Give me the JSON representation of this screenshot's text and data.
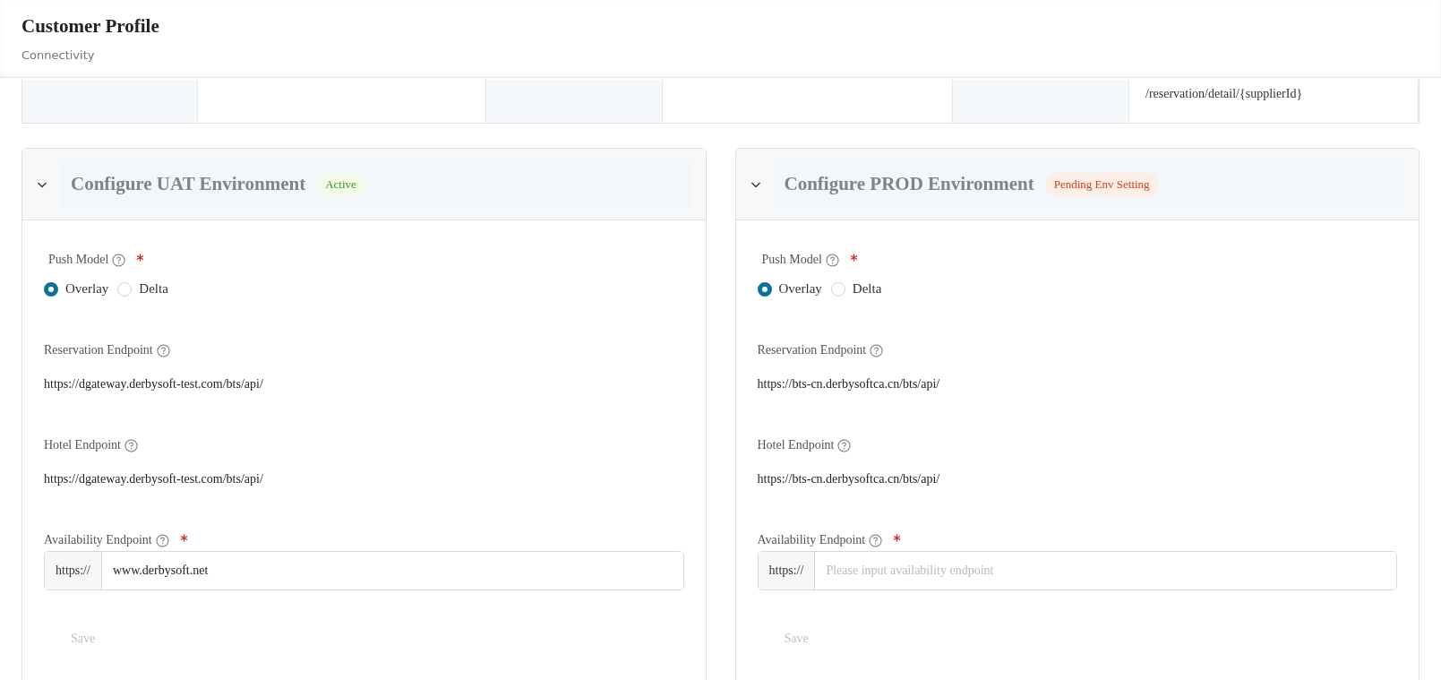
{
  "header": {
    "title": "Customer Profile",
    "subtitle": "Connectivity"
  },
  "top_row": {
    "cells": [
      {
        "kind": "label"
      },
      {
        "kind": "value"
      },
      {
        "kind": "label"
      },
      {
        "kind": "value"
      },
      {
        "kind": "label"
      },
      {
        "kind": "value",
        "text": "/reservation/detail/{supplierId}"
      }
    ]
  },
  "panels": [
    {
      "title": "Configure UAT Environment",
      "expanded": true,
      "status": {
        "label": "Active",
        "kind": "success"
      },
      "push_model": {
        "label": "Push Model",
        "required": true,
        "options": [
          {
            "label": "Overlay",
            "selected": true
          },
          {
            "label": "Delta",
            "selected": false
          }
        ]
      },
      "reservation_endpoint": {
        "label": "Reservation Endpoint",
        "value": "https://dgateway.derbysoft-test.com/bts/api/"
      },
      "hotel_endpoint": {
        "label": "Hotel Endpoint",
        "value": "https://dgateway.derbysoft-test.com/bts/api/"
      },
      "availability_endpoint": {
        "label": "Availability Endpoint",
        "required": true,
        "prefix": "https://",
        "value": "www.derbysoft.net"
      },
      "save": {
        "label": "Save",
        "disabled": true
      }
    },
    {
      "title": "Configure PROD Environment",
      "expanded": true,
      "status": {
        "label": "Pending Env Setting",
        "kind": "warning"
      },
      "push_model": {
        "label": "Push Model",
        "required": true,
        "options": [
          {
            "label": "Overlay",
            "selected": true
          },
          {
            "label": "Delta",
            "selected": false
          }
        ]
      },
      "reservation_endpoint": {
        "label": "Reservation Endpoint",
        "value": "https://bts-cn.derbysoftca.cn/bts/api/"
      },
      "hotel_endpoint": {
        "label": "Hotel Endpoint",
        "value": "https://bts-cn.derbysoftca.cn/bts/api/"
      },
      "availability_endpoint": {
        "label": "Availability Endpoint",
        "required": true,
        "prefix": "https://",
        "placeholder": "Please input availability endpoint"
      },
      "save": {
        "label": "Save",
        "disabled": true
      }
    }
  ]
}
